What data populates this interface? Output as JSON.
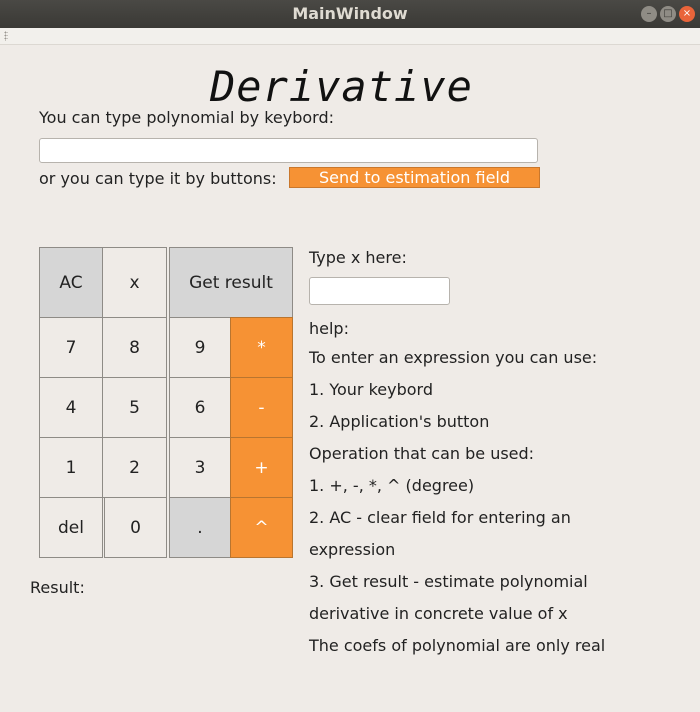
{
  "window": {
    "title": "MainWindow",
    "min": "–",
    "max": "□",
    "close": "×"
  },
  "heading": "Derivative",
  "input_section": {
    "keyboard_label": "You can type polynomial by keybord:",
    "keyboard_value": "",
    "buttons_label": "or you can type it by buttons:",
    "send_label": "Send to estimation field"
  },
  "keypad": {
    "ac": "AC",
    "x": "x",
    "get_result": "Get result",
    "k7": "7",
    "k8": "8",
    "k9": "9",
    "mul": "*",
    "k4": "4",
    "k5": "5",
    "k6": "6",
    "minus": "-",
    "k1": "1",
    "k2": "2",
    "k3": "3",
    "plus": "+",
    "del": "del",
    "k0": "0",
    "dot": ".",
    "pow": "^"
  },
  "x_section": {
    "label": "Type x here:",
    "value": ""
  },
  "result_label": "Result:",
  "help": {
    "title": "help:",
    "lines": [
      "To enter an expression you can use:",
      "1. Your keybord",
      "2. Application's button",
      "Operation that can be used:",
      "1. +, -, *, ^ (degree)",
      "2. AC - clear field for entering an",
      "expression",
      "3. Get result - estimate polynomial",
      "derivative in concrete value of x",
      "The coefs of polynomial are only real"
    ]
  }
}
